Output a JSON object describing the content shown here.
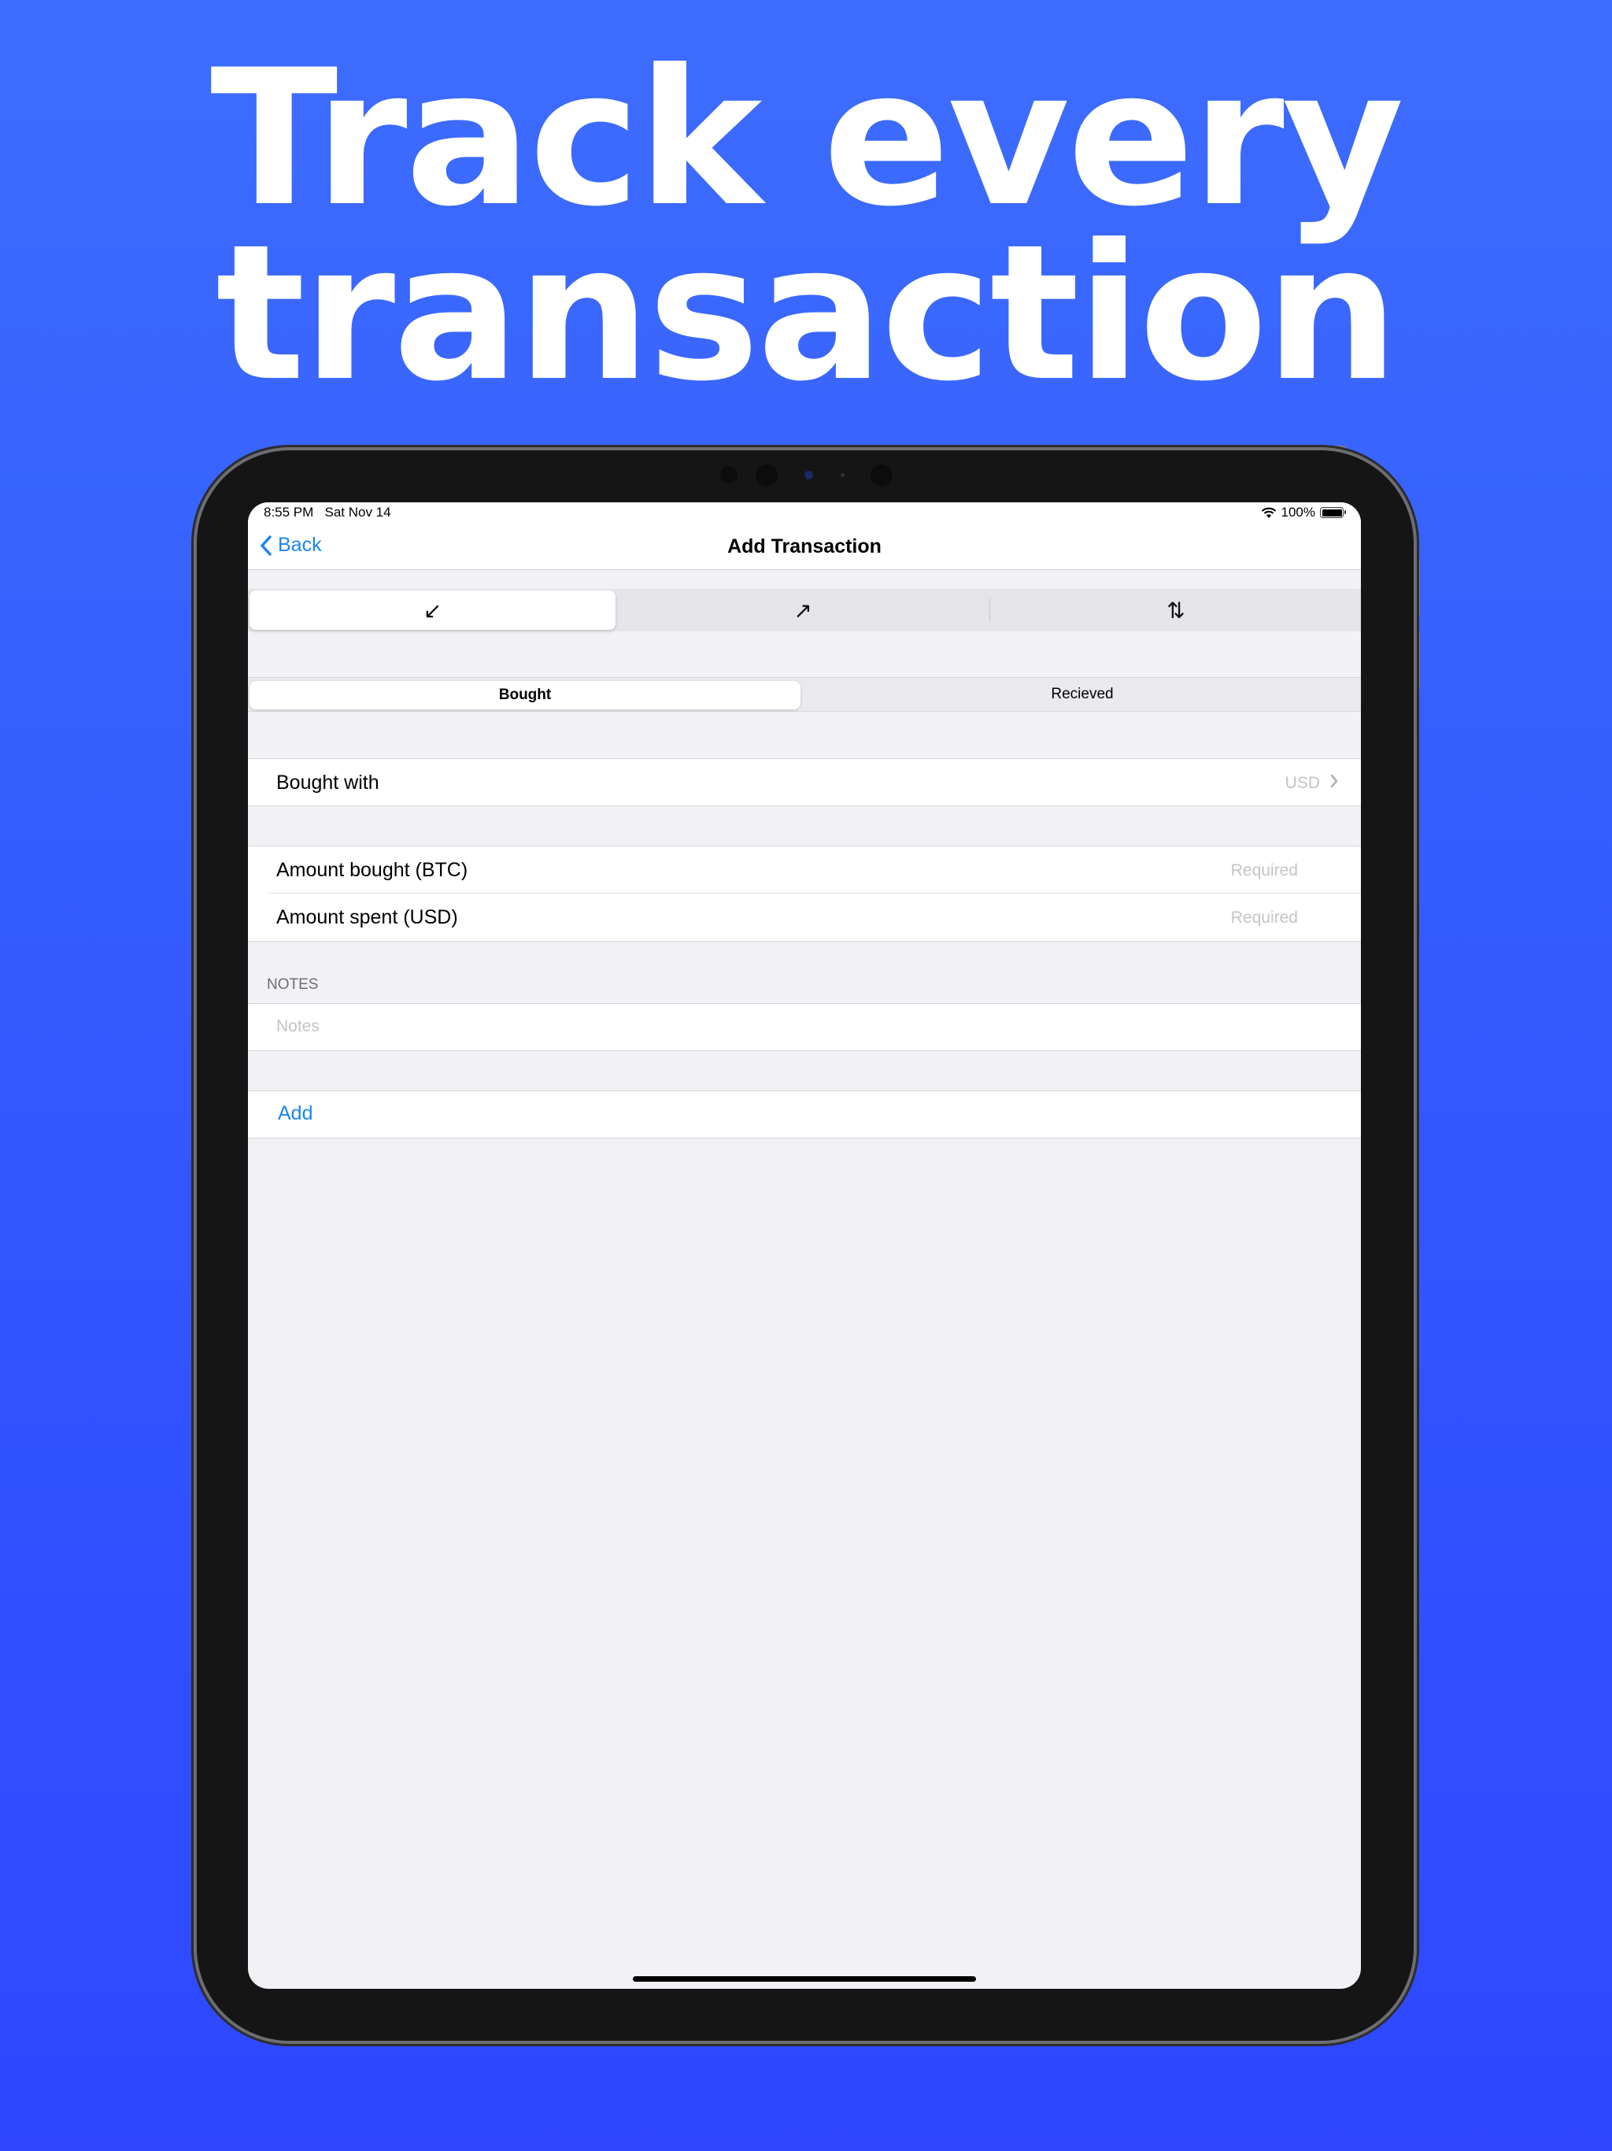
{
  "headline": {
    "line1": "Track every",
    "line2": "transaction"
  },
  "status_bar": {
    "time": "8:55 PM",
    "date": "Sat Nov 14",
    "battery": "100%",
    "wifi_icon": "wifi-icon",
    "battery_icon": "battery-icon"
  },
  "nav": {
    "back_label": "Back",
    "back_icon": "chevron-left-icon",
    "title": "Add Transaction"
  },
  "type_segments": [
    {
      "icon": "arrow-down-left-icon",
      "glyph": "↙",
      "selected": true
    },
    {
      "icon": "arrow-up-right-icon",
      "glyph": "↗",
      "selected": false
    },
    {
      "icon": "arrows-up-down-icon",
      "glyph": "⇅",
      "selected": false
    }
  ],
  "source_segments": [
    {
      "label": "Bought",
      "selected": true
    },
    {
      "label": "Recieved",
      "selected": false
    }
  ],
  "form": {
    "bought_with": {
      "label": "Bought with",
      "value": "USD"
    },
    "amount_bought": {
      "label": "Amount bought (BTC)",
      "placeholder": "Required"
    },
    "amount_spent": {
      "label": "Amount spent (USD)",
      "placeholder": "Required"
    },
    "notes_header": "NOTES",
    "notes_placeholder": "Notes",
    "add_label": "Add"
  },
  "colors": {
    "accent": "#1a86f2",
    "background_top": "#3d6dfe",
    "background_bottom": "#2e47ff"
  }
}
